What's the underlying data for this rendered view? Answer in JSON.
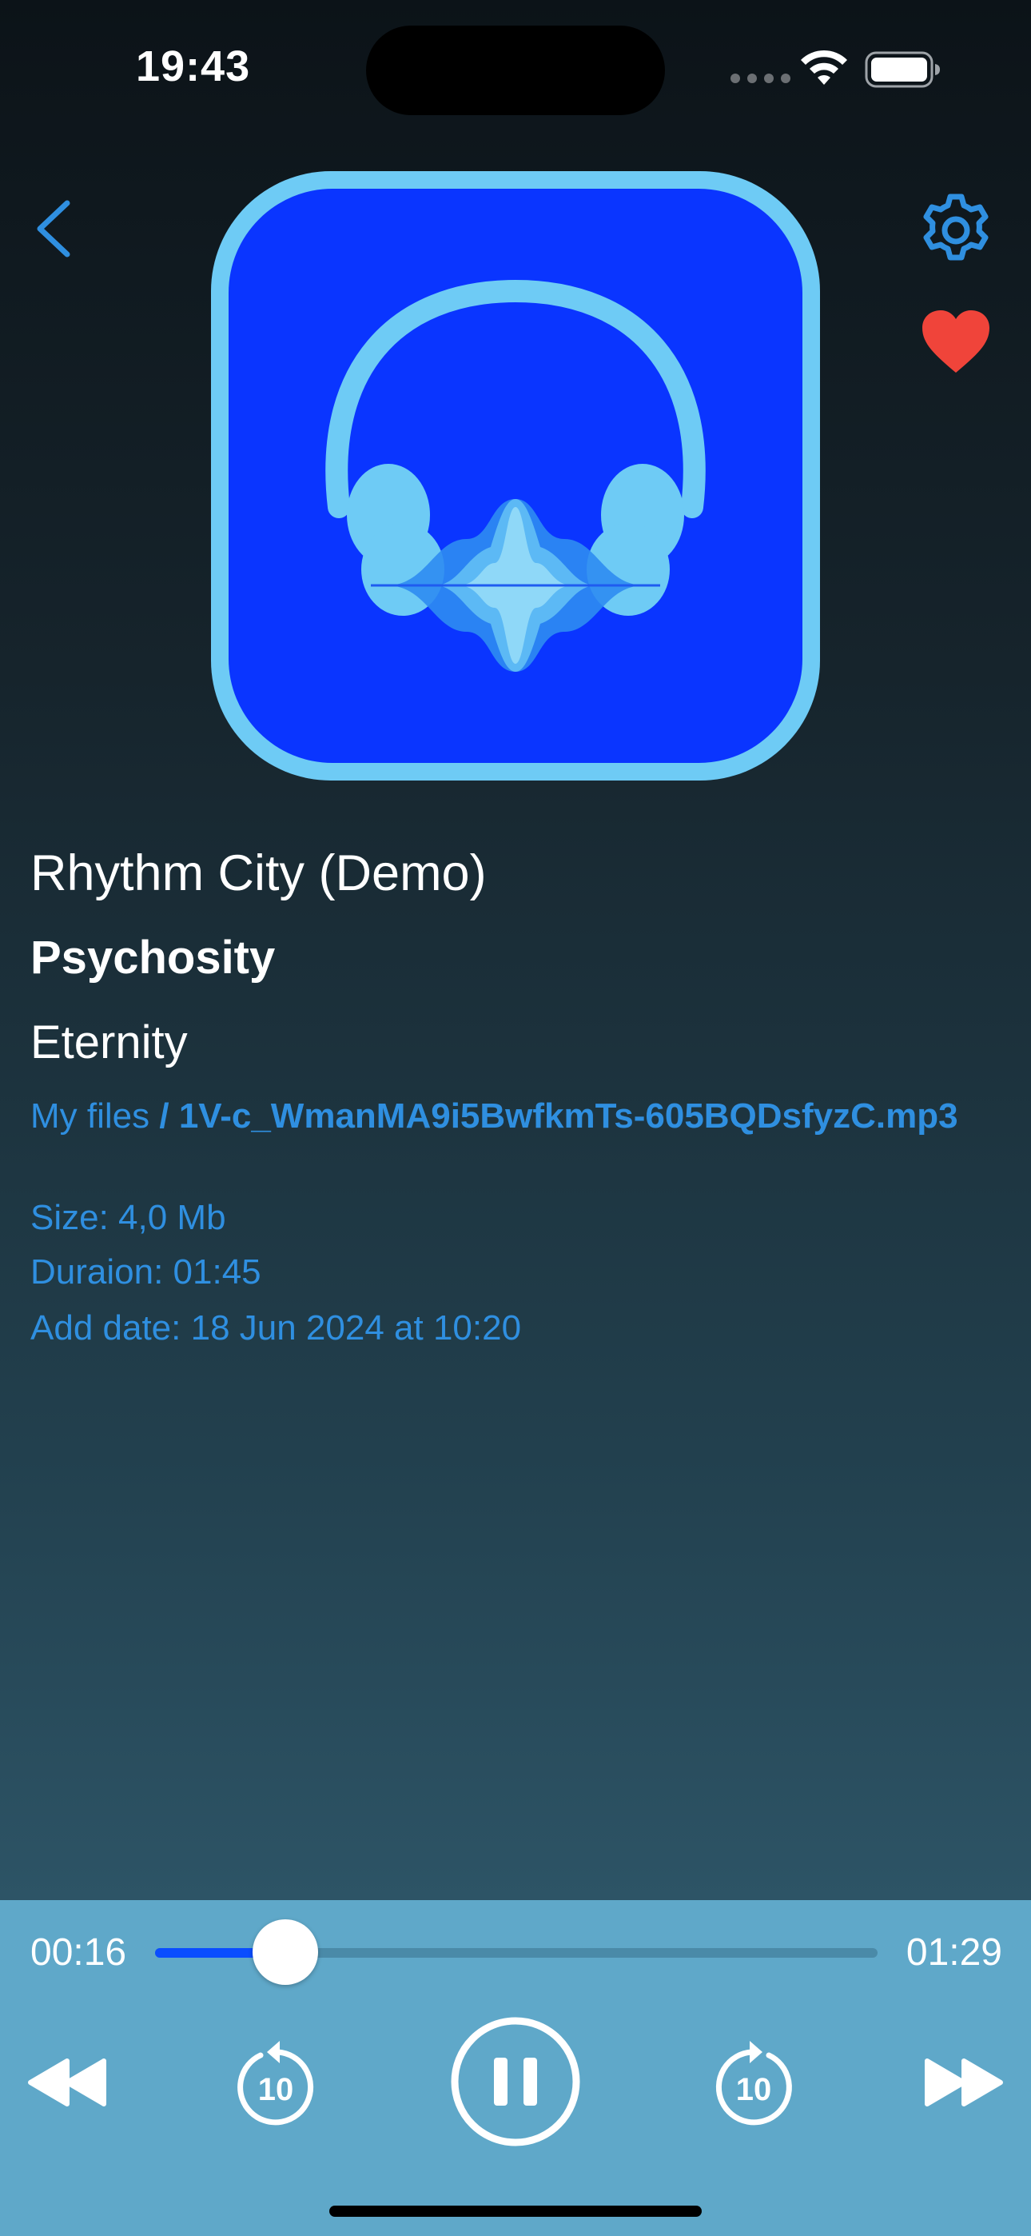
{
  "status_bar": {
    "time": "19:43",
    "icons": [
      "signal-dots-icon",
      "wifi-icon",
      "battery-icon"
    ]
  },
  "nav": {
    "back_icon": "chevron-left-icon",
    "settings_icon": "gear-icon",
    "favorite_icon": "heart-icon"
  },
  "track": {
    "artwork_icon": "headphones-waveform-icon",
    "title": "Rhythm City (Demo)",
    "artist": "Psychosity",
    "album": "Eternity"
  },
  "file_info": {
    "folder": "My files",
    "separator": " / ",
    "file_name": "1V-c_WmanMA9i5BwfkmTs-605BQDsfyzC.mp3",
    "size": "Size: 4,0 Mb",
    "duration": "Duraion: 01:45",
    "add_date": "Add date: 18 Jun 2024 at 10:20"
  },
  "player": {
    "current_time": "00:16",
    "total_time": "01:29",
    "progress_fraction": 0.18,
    "controls": [
      "rewind-icon",
      "skip-back-10-icon",
      "pause-icon",
      "skip-forward-10-icon",
      "fast-forward-icon"
    ],
    "skip_seconds_label": "10"
  },
  "colors": {
    "accent": "#2f8fe0",
    "favorite": "#f0443a",
    "artwork_bg": "#0a35ff",
    "artwork_rim": "#6ecbf5",
    "player_panel": "#5fa8c9",
    "progress_fill": "#0a4dff"
  }
}
